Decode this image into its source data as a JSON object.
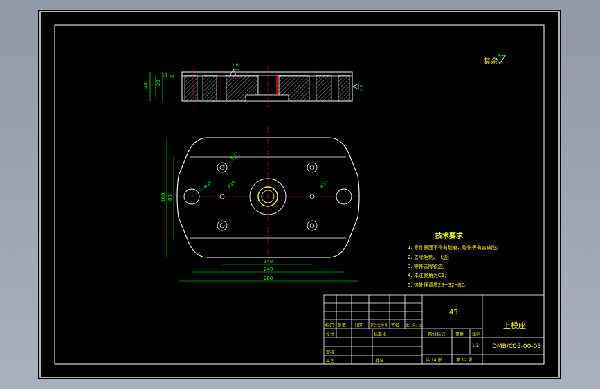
{
  "drawing": {
    "surface_note": {
      "text": "其余",
      "value": "3.2"
    },
    "front_view": {
      "dims": {
        "height_total": "40",
        "height_1": "28",
        "height_2": "12",
        "height_3": "8"
      },
      "roughness_1": "1.6",
      "roughness_2": "1.6"
    },
    "top_view": {
      "dim_width_small": "148",
      "dim_width_mid": "240",
      "dim_width_total": "280",
      "dim_height_total": "168",
      "dim_height_inner": "88",
      "dia_1": "Φ10",
      "dia_2": "Φ20",
      "dia_3": "Φ16",
      "dia_4": "Φ10"
    },
    "tech": {
      "title": "技术要求",
      "items": [
        "1. 零件表面不得有划痕、碰伤等有害缺陷;",
        "2. 去除毛刺、飞边;",
        "3. 零件去除锐边;",
        "4. 未注倒角为C1;",
        "5. 热处理调质28~32HRC。"
      ]
    },
    "title_block": {
      "material": "45",
      "part_name": "上模座",
      "drawing_no": "DMB/C05-00-03",
      "row_labels": [
        "标记",
        "处数",
        "分区",
        "更改文件号",
        "签名",
        "年、月、日"
      ],
      "designer_label": "设计",
      "standard_label": "标准化",
      "check_label": "审核",
      "process_label": "工艺",
      "approve_label": "批准",
      "stage_label": "阶段标记",
      "weight_label": "重量",
      "scale_label": "比例",
      "scale_value": "1:2",
      "sheet_total": "共 14 张",
      "sheet_no": "第 12 张"
    }
  }
}
